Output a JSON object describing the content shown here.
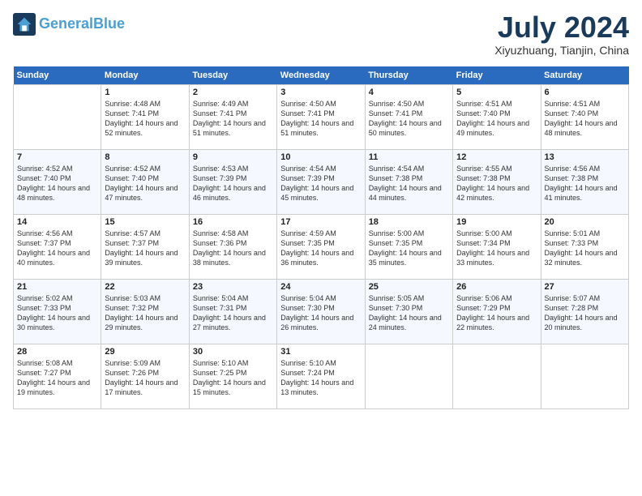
{
  "header": {
    "logo_line1": "General",
    "logo_line2": "Blue",
    "month": "July 2024",
    "location": "Xiyuzhuang, Tianjin, China"
  },
  "days_of_week": [
    "Sunday",
    "Monday",
    "Tuesday",
    "Wednesday",
    "Thursday",
    "Friday",
    "Saturday"
  ],
  "weeks": [
    [
      {
        "num": "",
        "empty": true
      },
      {
        "num": "1",
        "sunrise": "Sunrise: 4:48 AM",
        "sunset": "Sunset: 7:41 PM",
        "daylight": "Daylight: 14 hours and 52 minutes."
      },
      {
        "num": "2",
        "sunrise": "Sunrise: 4:49 AM",
        "sunset": "Sunset: 7:41 PM",
        "daylight": "Daylight: 14 hours and 51 minutes."
      },
      {
        "num": "3",
        "sunrise": "Sunrise: 4:50 AM",
        "sunset": "Sunset: 7:41 PM",
        "daylight": "Daylight: 14 hours and 51 minutes."
      },
      {
        "num": "4",
        "sunrise": "Sunrise: 4:50 AM",
        "sunset": "Sunset: 7:41 PM",
        "daylight": "Daylight: 14 hours and 50 minutes."
      },
      {
        "num": "5",
        "sunrise": "Sunrise: 4:51 AM",
        "sunset": "Sunset: 7:40 PM",
        "daylight": "Daylight: 14 hours and 49 minutes."
      },
      {
        "num": "6",
        "sunrise": "Sunrise: 4:51 AM",
        "sunset": "Sunset: 7:40 PM",
        "daylight": "Daylight: 14 hours and 48 minutes."
      }
    ],
    [
      {
        "num": "7",
        "sunrise": "Sunrise: 4:52 AM",
        "sunset": "Sunset: 7:40 PM",
        "daylight": "Daylight: 14 hours and 48 minutes."
      },
      {
        "num": "8",
        "sunrise": "Sunrise: 4:52 AM",
        "sunset": "Sunset: 7:40 PM",
        "daylight": "Daylight: 14 hours and 47 minutes."
      },
      {
        "num": "9",
        "sunrise": "Sunrise: 4:53 AM",
        "sunset": "Sunset: 7:39 PM",
        "daylight": "Daylight: 14 hours and 46 minutes."
      },
      {
        "num": "10",
        "sunrise": "Sunrise: 4:54 AM",
        "sunset": "Sunset: 7:39 PM",
        "daylight": "Daylight: 14 hours and 45 minutes."
      },
      {
        "num": "11",
        "sunrise": "Sunrise: 4:54 AM",
        "sunset": "Sunset: 7:38 PM",
        "daylight": "Daylight: 14 hours and 44 minutes."
      },
      {
        "num": "12",
        "sunrise": "Sunrise: 4:55 AM",
        "sunset": "Sunset: 7:38 PM",
        "daylight": "Daylight: 14 hours and 42 minutes."
      },
      {
        "num": "13",
        "sunrise": "Sunrise: 4:56 AM",
        "sunset": "Sunset: 7:38 PM",
        "daylight": "Daylight: 14 hours and 41 minutes."
      }
    ],
    [
      {
        "num": "14",
        "sunrise": "Sunrise: 4:56 AM",
        "sunset": "Sunset: 7:37 PM",
        "daylight": "Daylight: 14 hours and 40 minutes."
      },
      {
        "num": "15",
        "sunrise": "Sunrise: 4:57 AM",
        "sunset": "Sunset: 7:37 PM",
        "daylight": "Daylight: 14 hours and 39 minutes."
      },
      {
        "num": "16",
        "sunrise": "Sunrise: 4:58 AM",
        "sunset": "Sunset: 7:36 PM",
        "daylight": "Daylight: 14 hours and 38 minutes."
      },
      {
        "num": "17",
        "sunrise": "Sunrise: 4:59 AM",
        "sunset": "Sunset: 7:35 PM",
        "daylight": "Daylight: 14 hours and 36 minutes."
      },
      {
        "num": "18",
        "sunrise": "Sunrise: 5:00 AM",
        "sunset": "Sunset: 7:35 PM",
        "daylight": "Daylight: 14 hours and 35 minutes."
      },
      {
        "num": "19",
        "sunrise": "Sunrise: 5:00 AM",
        "sunset": "Sunset: 7:34 PM",
        "daylight": "Daylight: 14 hours and 33 minutes."
      },
      {
        "num": "20",
        "sunrise": "Sunrise: 5:01 AM",
        "sunset": "Sunset: 7:33 PM",
        "daylight": "Daylight: 14 hours and 32 minutes."
      }
    ],
    [
      {
        "num": "21",
        "sunrise": "Sunrise: 5:02 AM",
        "sunset": "Sunset: 7:33 PM",
        "daylight": "Daylight: 14 hours and 30 minutes."
      },
      {
        "num": "22",
        "sunrise": "Sunrise: 5:03 AM",
        "sunset": "Sunset: 7:32 PM",
        "daylight": "Daylight: 14 hours and 29 minutes."
      },
      {
        "num": "23",
        "sunrise": "Sunrise: 5:04 AM",
        "sunset": "Sunset: 7:31 PM",
        "daylight": "Daylight: 14 hours and 27 minutes."
      },
      {
        "num": "24",
        "sunrise": "Sunrise: 5:04 AM",
        "sunset": "Sunset: 7:30 PM",
        "daylight": "Daylight: 14 hours and 26 minutes."
      },
      {
        "num": "25",
        "sunrise": "Sunrise: 5:05 AM",
        "sunset": "Sunset: 7:30 PM",
        "daylight": "Daylight: 14 hours and 24 minutes."
      },
      {
        "num": "26",
        "sunrise": "Sunrise: 5:06 AM",
        "sunset": "Sunset: 7:29 PM",
        "daylight": "Daylight: 14 hours and 22 minutes."
      },
      {
        "num": "27",
        "sunrise": "Sunrise: 5:07 AM",
        "sunset": "Sunset: 7:28 PM",
        "daylight": "Daylight: 14 hours and 20 minutes."
      }
    ],
    [
      {
        "num": "28",
        "sunrise": "Sunrise: 5:08 AM",
        "sunset": "Sunset: 7:27 PM",
        "daylight": "Daylight: 14 hours and 19 minutes."
      },
      {
        "num": "29",
        "sunrise": "Sunrise: 5:09 AM",
        "sunset": "Sunset: 7:26 PM",
        "daylight": "Daylight: 14 hours and 17 minutes."
      },
      {
        "num": "30",
        "sunrise": "Sunrise: 5:10 AM",
        "sunset": "Sunset: 7:25 PM",
        "daylight": "Daylight: 14 hours and 15 minutes."
      },
      {
        "num": "31",
        "sunrise": "Sunrise: 5:10 AM",
        "sunset": "Sunset: 7:24 PM",
        "daylight": "Daylight: 14 hours and 13 minutes."
      },
      {
        "num": "",
        "empty": true
      },
      {
        "num": "",
        "empty": true
      },
      {
        "num": "",
        "empty": true
      }
    ]
  ]
}
